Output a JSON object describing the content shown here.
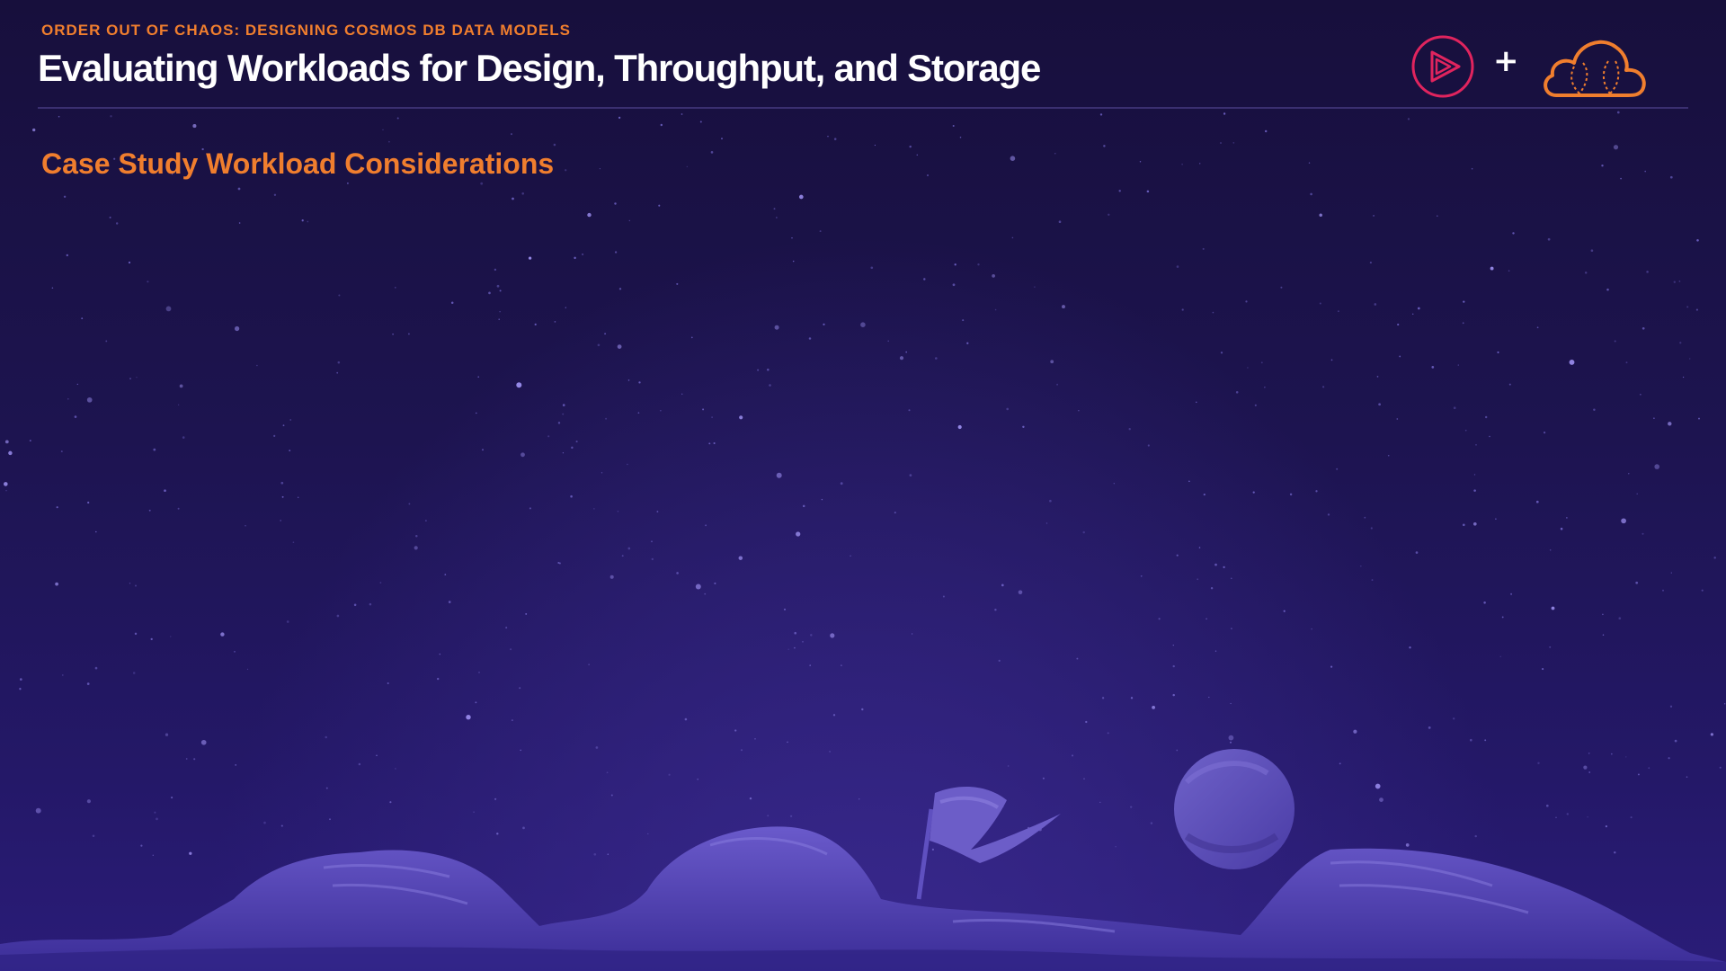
{
  "header": {
    "course_title": "ORDER OUT OF CHAOS: DESIGNING COSMOS DB DATA MODELS",
    "module_title": "Evaluating Workloads for Design, Throughput, and Storage",
    "logos": {
      "left_icon": "pluralsight-play-icon",
      "separator": "+",
      "right_icon": "cloud-icon"
    }
  },
  "content": {
    "heading": "Case Study Workload Considerations"
  },
  "colors": {
    "accent_orange": "#f07e2e",
    "play_logo": "#e0245e",
    "background": "#1b1247",
    "landscape": "#5b4bb8"
  }
}
